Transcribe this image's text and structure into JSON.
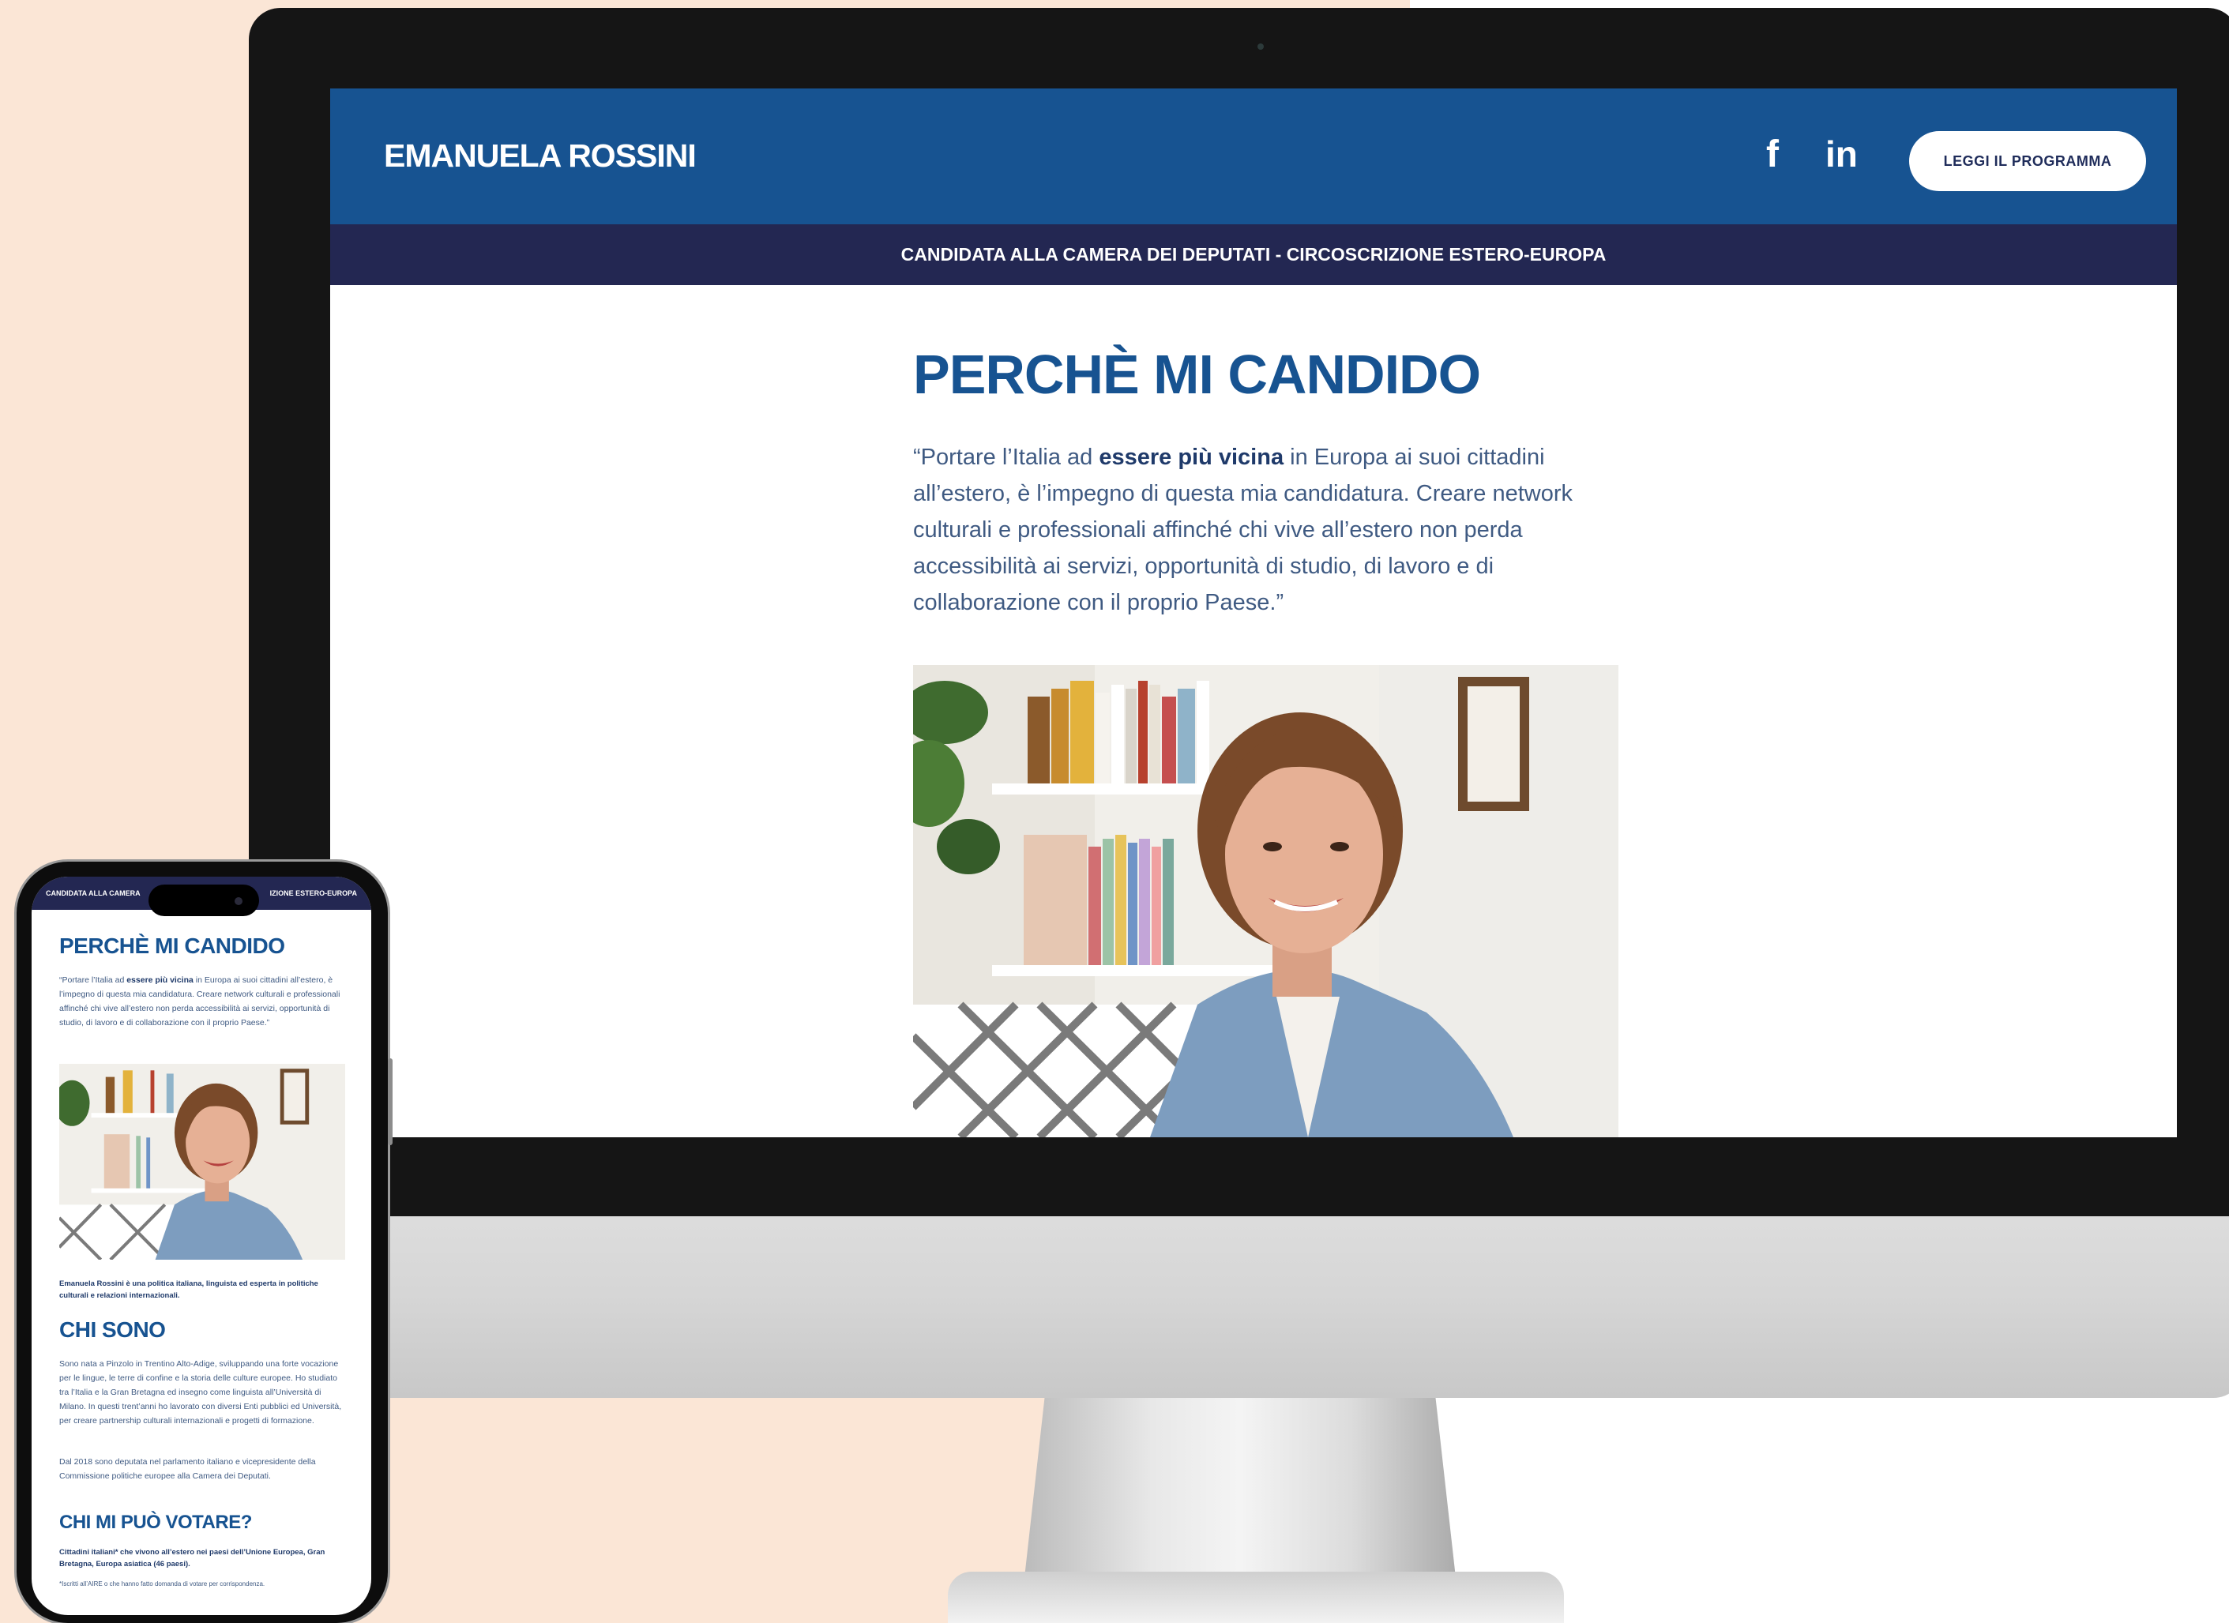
{
  "desktop": {
    "header": {
      "logo": "EMANUELA ROSSINI",
      "facebook_icon": "f",
      "linkedin_icon": "in",
      "cta_label": "LEGGI IL PROGRAMMA"
    },
    "subbar": "CANDIDATA ALLA CAMERA DEI DEPUTATI - CIRCOSCRIZIONE ESTERO-EUROPA",
    "section": {
      "title": "PERCHÈ MI CANDIDO",
      "quote_before": "“Portare l’Italia ad ",
      "quote_bold": "essere più vicina",
      "quote_after": " in Europa ai suoi cittadini all’estero, è l’impegno di questa mia candidatura. Creare network culturali e professionali affinché chi vive all’estero non perda accessibilità ai servizi, opportunità di studio, di lavoro e di collaborazione con il proprio Paese.”"
    }
  },
  "mobile": {
    "subbar_left": "CANDIDATA ALLA CAMERA",
    "subbar_right": "IZIONE ESTERO-EUROPA",
    "title": "PERCHÈ MI CANDIDO",
    "quote_before": "“Portare l’Italia ad ",
    "quote_bold": "essere più vicina",
    "quote_after": " in Europa ai suoi cittadini all’estero, è l’impegno di questa mia candidatura. Creare network culturali e professionali affinché chi vive all’estero non perda accessibilità ai servizi, opportunità di studio, di lavoro e di collaborazione con il proprio Paese.”",
    "caption": "Emanuela Rossini è una politica italiana, linguista ed esperta in politiche culturali e relazioni internazionali.",
    "chi_sono_title": "CHI SONO",
    "chi_sono_text": "Sono nata a Pinzolo in Trentino Alto-Adige, sviluppando una forte vocazione per le lingue, le terre di confine e la storia delle culture europee. Ho studiato tra l’Italia e la Gran Bretagna ed insegno come linguista all’Università di Milano. In questi trent’anni ho lavorato con diversi Enti pubblici ed Università, per creare partnership culturali internazionali e progetti di formazione.",
    "chi_sono_text2": "Dal 2018 sono deputata nel parlamento italiano e vicepresidente della Commissione politiche europee alla Camera dei Deputati.",
    "vote_title": "CHI MI PUÒ VOTARE?",
    "vote_bold": "Cittadini italiani* che vivono all’estero nei paesi dell’Unione Europea, Gran Bretagna, Europa asiatica (46 paesi).",
    "vote_note": "*Iscritti all’AIRE o che hanno fatto domanda di votare per corrispondenza."
  }
}
